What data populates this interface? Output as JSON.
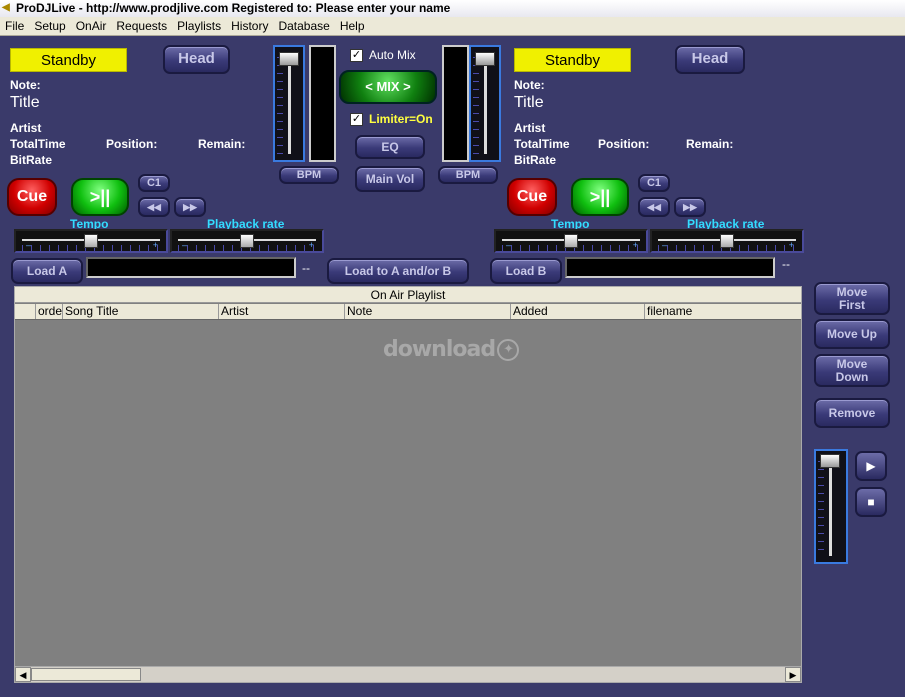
{
  "window": {
    "title": "ProDJLive - http://www.prodjlive.com Registered to:  Please enter your name"
  },
  "menu": [
    "File",
    "Setup",
    "OnAir",
    "Requests",
    "Playlists",
    "History",
    "Database",
    "Help"
  ],
  "deckA": {
    "status": "Standby",
    "head_label": "Head",
    "note_label": "Note:",
    "title": "Title",
    "artist_label": "Artist",
    "total_time_label": "TotalTime",
    "position_label": "Position:",
    "remain_label": "Remain:",
    "bitrate_label": "BitRate",
    "cue_label": "Cue",
    "play_label": ">||",
    "c1_label": "C1",
    "rew_label": "◀◀",
    "ffw_label": "▶▶",
    "tempo_label": "Tempo",
    "playback_label": "Playback rate",
    "tempo_value": 0.5,
    "playback_value": 0.5,
    "load_label": "Load A",
    "load_value": "",
    "dash": "--"
  },
  "deckB": {
    "status": "Standby",
    "head_label": "Head",
    "note_label": "Note:",
    "title": "Title",
    "artist_label": "Artist",
    "total_time_label": "TotalTime",
    "position_label": "Position:",
    "remain_label": "Remain:",
    "bitrate_label": "BitRate",
    "cue_label": "Cue",
    "play_label": ">||",
    "c1_label": "C1",
    "rew_label": "◀◀",
    "ffw_label": "▶▶",
    "tempo_label": "Tempo",
    "playback_label": "Playback rate",
    "tempo_value": 0.5,
    "playback_value": 0.5,
    "load_label": "Load B",
    "load_value": "",
    "dash": "--"
  },
  "mixer": {
    "auto_mix_label": "Auto Mix",
    "auto_mix_checked": true,
    "mix_label": "< MIX >",
    "limiter_label": "Limiter=On",
    "limiter_checked": true,
    "eq_label": "EQ",
    "main_vol_label": "Main Vol",
    "bpm_a_label": "BPM",
    "bpm_b_label": "BPM",
    "load_ab_label": "Load to A and/or B"
  },
  "playlist": {
    "header": "On Air Playlist",
    "columns": [
      "",
      "orde",
      "Song Title",
      "Artist",
      "Note",
      "Added",
      "filename"
    ],
    "rows": [],
    "watermark": "download"
  },
  "side": {
    "move_first": [
      "Move",
      "First"
    ],
    "move_up": "Move Up",
    "move_down": [
      "Move",
      "Down"
    ],
    "remove": "Remove",
    "play_icon": "▶",
    "stop_icon": "■"
  },
  "colors": {
    "background": "#3a3a6a",
    "standby": "#f0f000",
    "cue": "#d00000",
    "play": "#10c010",
    "accent_cyan": "#33ddff",
    "limiter": "#ffff40"
  },
  "icons": {
    "title_icon": "speaker-icon",
    "play": "play-pause-icon",
    "rewind": "rewind-icon",
    "forward": "fast-forward-icon",
    "checkbox": "check-icon"
  }
}
